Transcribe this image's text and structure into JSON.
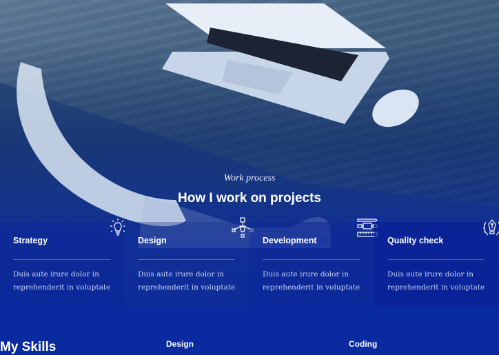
{
  "hero": {
    "subtitle": "Work process",
    "title": "How I work on projects"
  },
  "process": {
    "cards": [
      {
        "title": "Strategy",
        "description": "Duis aute irure dolor in reprehenderit in voluptate",
        "icon": "lightbulb-icon"
      },
      {
        "title": "Design",
        "description": "Duis aute irure dolor in reprehenderit in voluptate",
        "icon": "pen-tool-icon"
      },
      {
        "title": "Development",
        "description": "Duis aute irure dolor in reprehenderit in voluptate",
        "icon": "flowchart-ruler-icon"
      },
      {
        "title": "Quality check",
        "description": "Duis aute irure dolor in reprehenderit in voluptate",
        "icon": "fountain-pen-laurel-icon"
      }
    ]
  },
  "skills": {
    "title": "My Skills",
    "columns": [
      "Design",
      "Coding"
    ]
  },
  "colors": {
    "accent": "#0a2aa0",
    "text": "#ffffff",
    "muted_text": "#c9d4f5"
  }
}
